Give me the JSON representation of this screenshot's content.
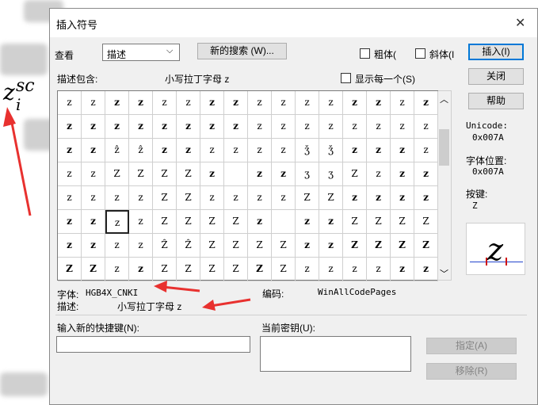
{
  "background": {
    "formula_base": "z",
    "formula_sup": "sc",
    "formula_sub": "i"
  },
  "dialog": {
    "title": "插入符号",
    "close_glyph": "✕",
    "view_label": "查看",
    "view_select_value": "描述",
    "new_search_button": "新的搜索 (W)...",
    "bold_label": "粗体(",
    "italic_label": "斜体(I",
    "insert_button": "插入(I)",
    "close_button": "关闭",
    "help_button": "帮助",
    "desc_contains_label": "描述包含:",
    "desc_contains_value": "小写拉丁字母 z",
    "show_each_label": "显示每一个(S)",
    "unicode_label": "Unicode:",
    "unicode_value": "0x007A",
    "char_pos_label": "字体位置:",
    "char_pos_value": "0x007A",
    "key_label": "按键:",
    "key_value": "Z",
    "preview_char": "z",
    "font_label": "字体:",
    "font_value": "HGB4X_CNKI",
    "encoding_label": "编码:",
    "encoding_value": "WinAllCodePages",
    "desc_label": "描述:",
    "desc_value": "小写拉丁字母 z",
    "new_shortcut_label": "输入新的快捷键(N):",
    "current_key_label": "当前密钥(U):",
    "assign_button": "指定(A)",
    "remove_button": "移除(R)",
    "scroll_up_glyph": "︿",
    "scroll_down_glyph": "﹀"
  },
  "grid": {
    "rows": [
      [
        "z",
        "z",
        "z",
        "z",
        "z",
        "z",
        "z",
        "z",
        "z",
        "z",
        "z",
        "z",
        "z",
        "z",
        "z",
        "z"
      ],
      [
        "z",
        "z",
        "z",
        "z",
        "z",
        "z",
        "z",
        "z",
        "z",
        "z",
        "z",
        "z",
        "z",
        "z",
        "z",
        "z"
      ],
      [
        "z",
        "z",
        "ẑ",
        "ẑ",
        "z",
        "z",
        "z",
        "z",
        "z",
        "z",
        "ǯ",
        "ǯ",
        "z",
        "z",
        "z",
        "z"
      ],
      [
        "z",
        "z",
        "Z",
        "Z",
        "Z",
        "Z",
        "z",
        "",
        "z",
        "z",
        "ʒ",
        "ʒ",
        "Z",
        "z",
        "z",
        "z"
      ],
      [
        "z",
        "z",
        "z",
        "z",
        "Z",
        "Z",
        "z",
        "z",
        "z",
        "z",
        "Z",
        "Z",
        "z",
        "z",
        "z",
        "z"
      ],
      [
        "z",
        "z",
        "z",
        "z",
        "Z",
        "Z",
        "Z",
        "Z",
        "z",
        "",
        "z",
        "z",
        "Z",
        "Z",
        "Z",
        "Z"
      ],
      [
        "z",
        "z",
        "z",
        "z",
        "Ẑ",
        "Ẑ",
        "Z",
        "Z",
        "Z",
        "Z",
        "z",
        "z",
        "Z",
        "Z",
        "Z",
        "Z"
      ],
      [
        "Z",
        "Z",
        "z",
        "z",
        "Z",
        "Z",
        "Z",
        "Z",
        "Z",
        "Z",
        "z",
        "z",
        "z",
        "z",
        "z",
        "z"
      ]
    ],
    "bold_rows": [
      [
        0,
        0,
        1,
        1,
        0,
        0,
        1,
        1,
        0,
        0,
        0,
        0,
        1,
        1,
        0,
        1
      ],
      [
        1,
        1,
        1,
        1,
        1,
        1,
        1,
        1,
        0,
        0,
        0,
        0,
        0,
        0,
        0,
        0
      ],
      [
        1,
        1,
        0,
        0,
        1,
        1,
        0,
        0,
        0,
        0,
        0,
        0,
        1,
        1,
        1,
        0
      ],
      [
        0,
        0,
        0,
        0,
        0,
        0,
        1,
        0,
        1,
        1,
        0,
        0,
        0,
        0,
        1,
        1
      ],
      [
        0,
        0,
        0,
        0,
        0,
        0,
        0,
        0,
        0,
        0,
        0,
        0,
        1,
        1,
        1,
        1
      ],
      [
        1,
        1,
        0,
        0,
        0,
        0,
        0,
        0,
        1,
        0,
        1,
        1,
        0,
        0,
        0,
        0
      ],
      [
        1,
        1,
        0,
        0,
        0,
        0,
        0,
        0,
        0,
        0,
        1,
        1,
        1,
        1,
        1,
        1
      ],
      [
        1,
        1,
        0,
        1,
        0,
        0,
        0,
        0,
        1,
        0,
        0,
        0,
        0,
        0,
        1,
        1
      ]
    ],
    "selected_row": 5,
    "selected_col": 2
  }
}
